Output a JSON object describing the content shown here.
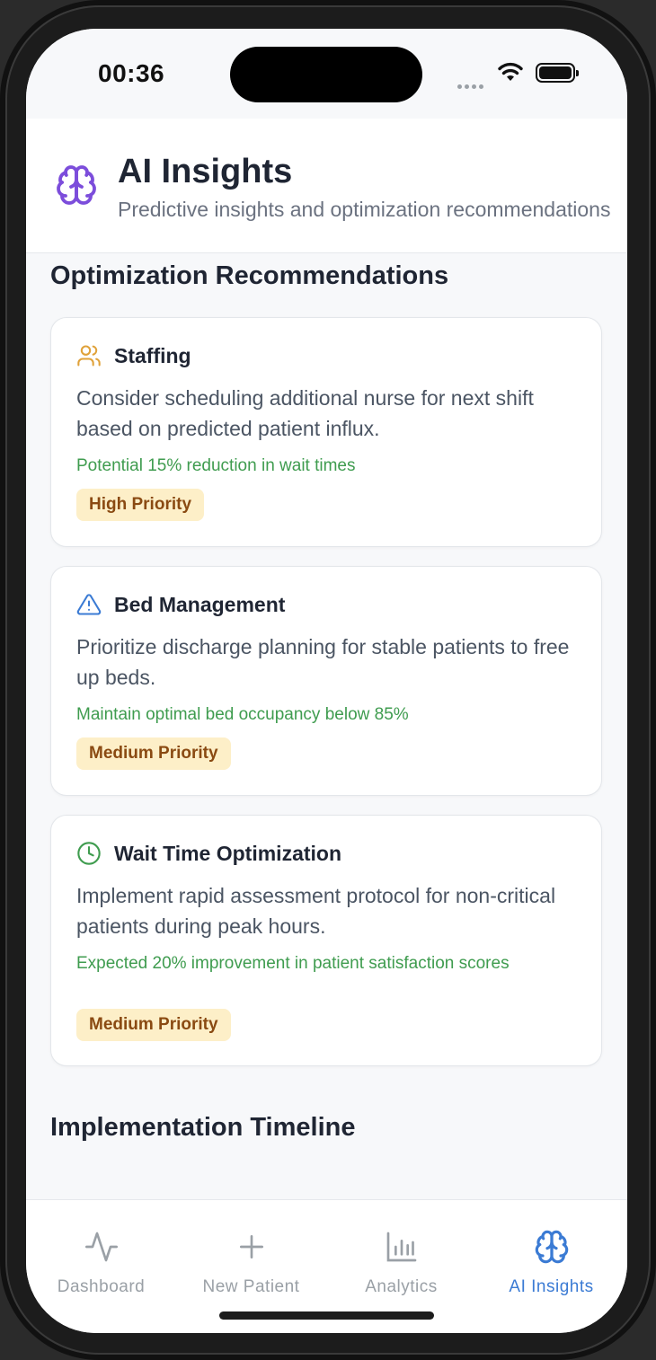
{
  "status_bar": {
    "time": "00:36"
  },
  "header": {
    "title": "AI Insights",
    "subtitle": "Predictive insights and optimization recommendations",
    "icon": "brain-icon"
  },
  "sections": {
    "recommendations_title": "Optimization Recommendations",
    "timeline_title": "Implementation Timeline"
  },
  "recommendations": [
    {
      "icon": "users-icon",
      "title": "Staffing",
      "description": "Consider scheduling additional nurse for next shift based on predicted patient influx.",
      "impact": "Potential 15% reduction in wait times",
      "priority": "High Priority"
    },
    {
      "icon": "alert-triangle-icon",
      "title": "Bed Management",
      "description": "Prioritize discharge planning for stable patients to free up beds.",
      "impact": "Maintain optimal bed occupancy below 85%",
      "priority": "Medium Priority"
    },
    {
      "icon": "clock-icon",
      "title": "Wait Time Optimization",
      "description": "Implement rapid assessment protocol for non-critical patients during peak hours.",
      "impact": "Expected 20% improvement in patient satisfaction scores",
      "priority": "Medium Priority"
    }
  ],
  "tabs": [
    {
      "label": "Dashboard",
      "icon": "activity-icon",
      "active": false
    },
    {
      "label": "New Patient",
      "icon": "plus-icon",
      "active": false
    },
    {
      "label": "Analytics",
      "icon": "bar-chart-icon",
      "active": false
    },
    {
      "label": "AI Insights",
      "icon": "brain-icon",
      "active": true
    }
  ],
  "colors": {
    "accent_purple": "#7c4ddb",
    "accent_blue": "#3b7bd4",
    "impact_green": "#3f9c4f",
    "staffing_orange": "#e0a23a",
    "bed_blue": "#3b7bd4",
    "wait_green": "#3f9c4f",
    "badge_bg": "#fdefc8",
    "badge_text": "#8a4a12"
  }
}
